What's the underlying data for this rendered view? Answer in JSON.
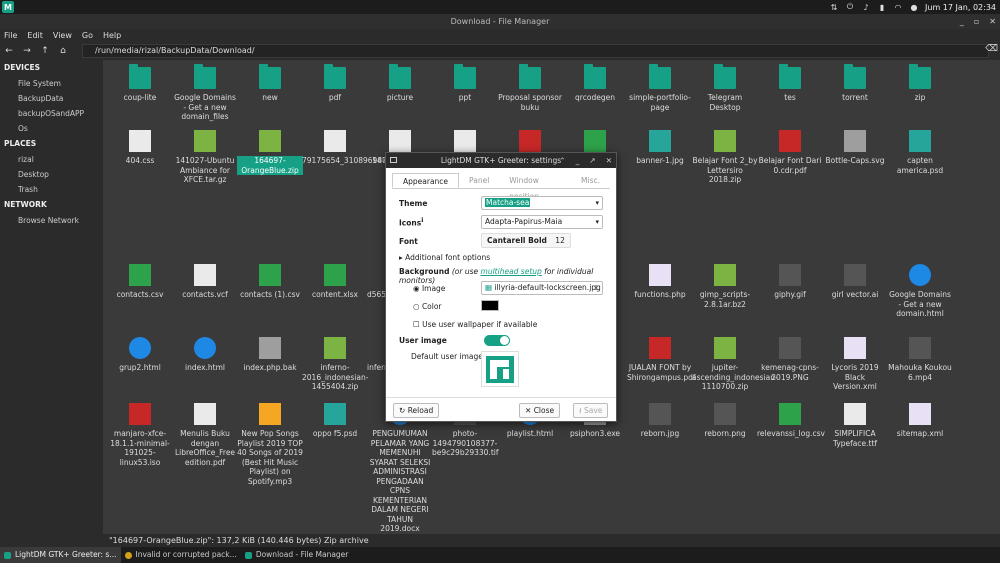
{
  "top_panel": {
    "clock": "Jum 17 Jan, 02:34",
    "icons": [
      "app-menu-icon",
      "network-icon",
      "power-icon",
      "volume-icon",
      "battery-icon",
      "wifi-icon",
      "notification-icon"
    ]
  },
  "window": {
    "title": "Download - File Manager"
  },
  "menu": [
    "File",
    "Edit",
    "View",
    "Go",
    "Help"
  ],
  "location": {
    "path": "/run/media/rizal/BackupData/Download/"
  },
  "sidebar": {
    "devices_header": "DEVICES",
    "devices": [
      "File System",
      "BackupData",
      "backupOSandAPP",
      "Os"
    ],
    "places_header": "PLACES",
    "places": [
      "rizal",
      "Desktop",
      "Trash"
    ],
    "network_header": "NETWORK",
    "network": [
      "Browse Network"
    ]
  },
  "files": [
    {
      "name": "coup-lite",
      "type": "folder"
    },
    {
      "name": "Google Domains - Get a new domain_files",
      "type": "folder"
    },
    {
      "name": "new",
      "type": "folder"
    },
    {
      "name": "pdf",
      "type": "folder"
    },
    {
      "name": "picture",
      "type": "folder"
    },
    {
      "name": "ppt",
      "type": "folder"
    },
    {
      "name": "Proposal sponsor buku",
      "type": "folder"
    },
    {
      "name": "qrcodegen",
      "type": "folder"
    },
    {
      "name": "simple-portfolio-page",
      "type": "folder"
    },
    {
      "name": "Telegram Desktop",
      "type": "folder"
    },
    {
      "name": "tes",
      "type": "folder"
    },
    {
      "name": "torrent",
      "type": "folder"
    },
    {
      "name": "zip",
      "type": "folder"
    },
    {
      "name": "404.css",
      "type": "doc"
    },
    {
      "name": "141027-Ubuntu Ambiance for XFCE.tar.gz",
      "type": "zip"
    },
    {
      "name": "164697-OrangeBlue.zip",
      "type": "zip",
      "selected": true
    },
    {
      "name": "79175654_3108969809116428_7138304064781025280_o.jpg",
      "type": "doc"
    },
    {
      "name": "1471...21_ka...",
      "type": "doc"
    },
    {
      "name": "",
      "type": "doc"
    },
    {
      "name": "",
      "type": "red"
    },
    {
      "name": "",
      "type": "green"
    },
    {
      "name": "banner-1.jpg",
      "type": "teal"
    },
    {
      "name": "Belajar Font 2_by Lettersiro 2018.zip",
      "type": "zip"
    },
    {
      "name": "Belajar Font Dari 0.cdr.pdf",
      "type": "red"
    },
    {
      "name": "Bottle-Caps.svg",
      "type": "gray"
    },
    {
      "name": "capten america.psd",
      "type": "teal"
    },
    {
      "name": "contacts.csv",
      "type": "green"
    },
    {
      "name": "contacts.vcf",
      "type": "doc"
    },
    {
      "name": "contacts (1).csv",
      "type": "green"
    },
    {
      "name": "content.xlsx",
      "type": "green"
    },
    {
      "name": "d565...3f1c...55e-3...",
      "type": "doc"
    },
    {
      "name": "functions.php",
      "type": "purple"
    },
    {
      "name": "gimp_scripts-2.8.1ar.bz2",
      "type": "zip"
    },
    {
      "name": "giphy.gif",
      "type": "dark"
    },
    {
      "name": "girl vector.ai",
      "type": "dark"
    },
    {
      "name": "Google Domains - Get a new domain.html",
      "type": "blue"
    },
    {
      "name": "grup2.html",
      "type": "blue"
    },
    {
      "name": "index.html",
      "type": "blue"
    },
    {
      "name": "index.php.bak",
      "type": "gray"
    },
    {
      "name": "inferno-2016_indonesian-1455404.zip",
      "type": "zip"
    },
    {
      "name": "inferno-...onesian...",
      "type": "zip"
    },
    {
      "name": "JUALAN FONT by Shirongampus.pdf",
      "type": "red"
    },
    {
      "name": "jupiter-ascending_indonesian-1110700.zip",
      "type": "zip"
    },
    {
      "name": "kemenag-cpns-2019.PNG",
      "type": "dark"
    },
    {
      "name": "Lycoris 2019 Black Version.xml",
      "type": "purple"
    },
    {
      "name": "Mahouka Koukou 6.mp4",
      "type": "dark"
    },
    {
      "name": "manjaro-xfce-18.1.1-minimal-191025-linux53.iso",
      "type": "red"
    },
    {
      "name": "Menulis Buku dengan LibreOffice_Free edition.pdf",
      "type": "doc"
    },
    {
      "name": "New Pop Songs Playlist 2019 TOP 40 Songs of 2019 (Best Hit Music Playlist) on Spotify.mp3",
      "type": "orange"
    },
    {
      "name": "oppo f5.psd",
      "type": "teal"
    },
    {
      "name": "PENGUMUMAN PELAMAR YANG MEMENUHI SYARAT SELEKSI ADMINISTRASI PENGADAAN CPNS KEMENTERIAN DALAM NEGERI TAHUN 2019.docx",
      "type": "blue"
    },
    {
      "name": "photo-1494790108377-be9c29b29330.tif",
      "type": "dark"
    },
    {
      "name": "playlist.html",
      "type": "blue"
    },
    {
      "name": "psiphon3.exe",
      "type": "gray"
    },
    {
      "name": "reborn.jpg",
      "type": "dark"
    },
    {
      "name": "reborn.png",
      "type": "dark"
    },
    {
      "name": "relevanssi_log.csv",
      "type": "green"
    },
    {
      "name": "SIMPLIFICA Typeface.ttf",
      "type": "doc"
    },
    {
      "name": "sitemap.xml",
      "type": "purple"
    }
  ],
  "statusbar": {
    "text": "\"164697-OrangeBlue.zip\": 137,2 KiB (140.446 bytes) Zip archive"
  },
  "taskbar": [
    {
      "label": "LightDM GTK+ Greeter: s...",
      "active": true
    },
    {
      "label": "Invalid or corrupted pack...",
      "active": false
    },
    {
      "label": "Download - File Manager",
      "active": false
    }
  ],
  "dialog": {
    "title": "LightDM GTK+ Greeter: settings",
    "tabs": [
      "Appearance",
      "Panel",
      "Window position",
      "Misc."
    ],
    "theme_label": "Theme",
    "theme_value": "Matcha-sea",
    "icons_label": "Icons",
    "icons_value": "Adapta-Papirus-Maia",
    "font_label": "Font",
    "font_value": "Cantarell Bold",
    "font_size": "12",
    "additional_font": "Additional font options",
    "background_label": "Background",
    "background_hint_pre": "(or use ",
    "background_hint_link": "multihead setup",
    "background_hint_post": " for individual monitors)",
    "image_option": "Image",
    "image_file": "illyria-default-lockscreen.jpg",
    "color_option": "Color",
    "color_value": "#000000",
    "user_wallpaper": "Use user wallpaper if available",
    "user_image_label": "User image",
    "default_user_image": "Default user image",
    "reload_label": "Reload",
    "close_label": "Close",
    "save_label": "Save",
    "accent": "#16a085"
  }
}
